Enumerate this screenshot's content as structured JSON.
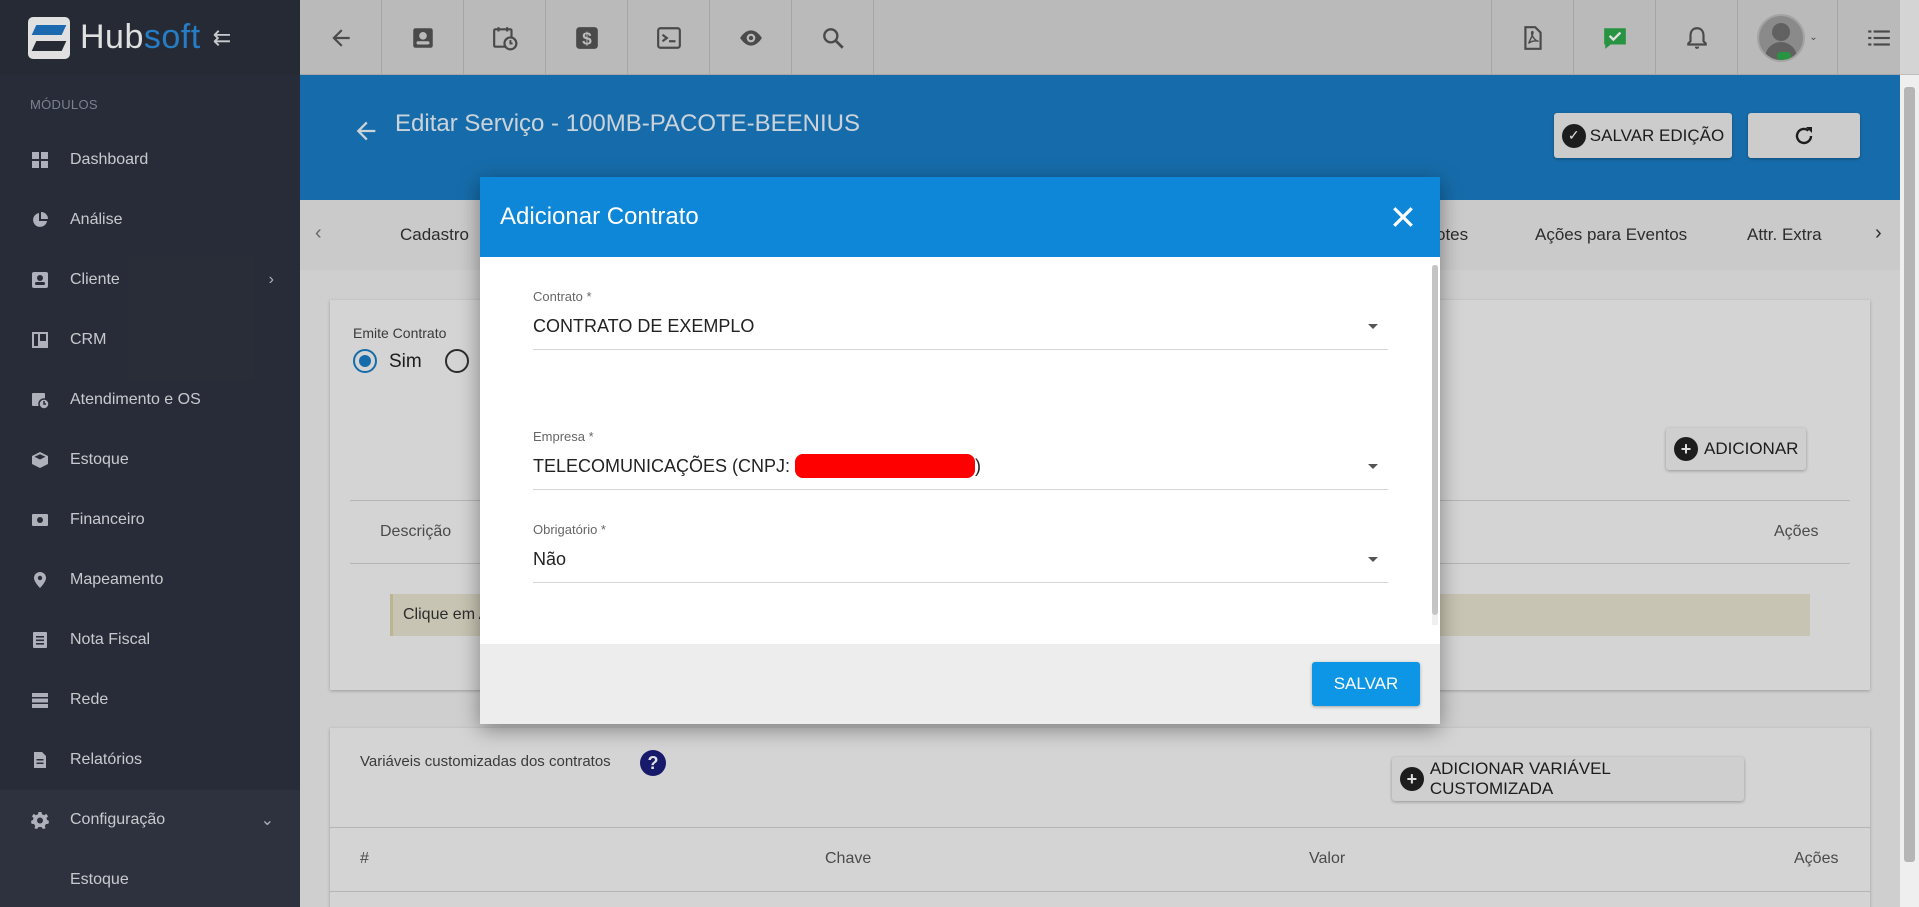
{
  "app": {
    "brand_part1": "Hub",
    "brand_part2": "soft",
    "brand_color": "#2d8fe0"
  },
  "sidebar": {
    "section_label": "MÓDULOS",
    "items": [
      {
        "label": "Dashboard",
        "icon": "grid-icon"
      },
      {
        "label": "Análise",
        "icon": "pie-chart-icon"
      },
      {
        "label": "Cliente",
        "icon": "contact-card-icon",
        "chevron": "›"
      },
      {
        "label": "CRM",
        "icon": "kanban-icon"
      },
      {
        "label": "Atendimento e OS",
        "icon": "calendar-clock-icon"
      },
      {
        "label": "Estoque",
        "icon": "box-icon"
      },
      {
        "label": "Financeiro",
        "icon": "money-icon"
      },
      {
        "label": "Mapeamento",
        "icon": "map-pin-icon"
      },
      {
        "label": "Nota Fiscal",
        "icon": "document-list-icon"
      },
      {
        "label": "Rede",
        "icon": "server-icon"
      },
      {
        "label": "Relatórios",
        "icon": "report-icon"
      },
      {
        "label": "Configuração",
        "icon": "gear-icon",
        "chevron": "⌄"
      }
    ],
    "sub_item": "Estoque"
  },
  "header": {
    "title": "Editar Serviço - 100MB-PACOTE-BEENIUS",
    "save_edit_label": "SALVAR EDIÇÃO"
  },
  "tabs": {
    "items": [
      "Cadastro",
      "otes",
      "Ações para Eventos",
      "Attr. Extra"
    ]
  },
  "contract_card": {
    "emite_label": "Emite Contrato",
    "sim_label": "Sim",
    "add_label": "ADICIONAR",
    "col_descricao": "Descrição",
    "col_acoes": "Ações",
    "info_text": "Clique em A"
  },
  "vars_card": {
    "title": "Variáveis customizadas dos contratos",
    "help": "?",
    "add_label": "ADICIONAR VARIÁVEL CUSTOMIZADA",
    "col_hash": "#",
    "col_chave": "Chave",
    "col_valor": "Valor",
    "col_acoes": "Ações"
  },
  "modal": {
    "title": "Adicionar Contrato",
    "contrato_label": "Contrato *",
    "contrato_value": "CONTRATO DE EXEMPLO",
    "empresa_label": "Empresa *",
    "empresa_prefix": "TELECOMUNICAÇÕES (CNPJ:",
    "empresa_suffix": ")",
    "obrigatorio_label": "Obrigatório *",
    "obrigatorio_value": "Não",
    "save_label": "SALVAR"
  }
}
